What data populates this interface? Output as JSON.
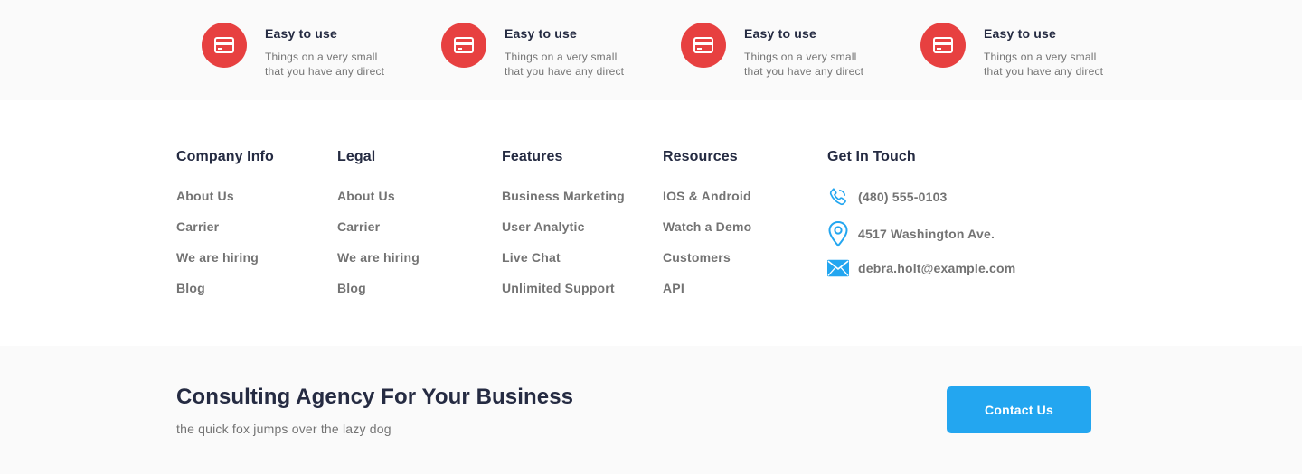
{
  "features": [
    {
      "icon": "credit-card-icon",
      "title": "Easy to use",
      "description": "Things on a very  small\nthat you have any direct"
    },
    {
      "icon": "credit-card-icon",
      "title": "Easy to use",
      "description": "Things on a very  small\nthat you have any direct"
    },
    {
      "icon": "credit-card-icon",
      "title": "Easy to use",
      "description": "Things on a very  small\nthat you have any direct"
    },
    {
      "icon": "credit-card-icon",
      "title": "Easy to use",
      "description": "Things on a very  small\nthat you have any direct"
    }
  ],
  "footer": {
    "columns": [
      {
        "title": "Company Info",
        "links": [
          "About Us",
          "Carrier",
          "We are hiring",
          "Blog"
        ]
      },
      {
        "title": "Legal",
        "links": [
          "About Us",
          "Carrier",
          "We are hiring",
          "Blog"
        ]
      },
      {
        "title": "Features",
        "links": [
          "Business Marketing",
          "User Analytic",
          "Live Chat",
          "Unlimited Support"
        ]
      },
      {
        "title": "Resources",
        "links": [
          "IOS & Android",
          "Watch a Demo",
          "Customers",
          "API"
        ]
      }
    ],
    "contact": {
      "title": "Get In Touch",
      "phone": "(480) 555-0103",
      "address": "4517 Washington Ave.",
      "email": "debra.holt@example.com"
    }
  },
  "cta": {
    "title": "Consulting Agency For Your Business",
    "subtitle": "the quick fox jumps over the lazy dog",
    "button_label": "Contact Us"
  },
  "colors": {
    "accent_red": "#E74040",
    "primary_blue": "#23A6F0",
    "heading": "#252B42",
    "muted_text": "#737373",
    "light_bg": "#FAFAFA"
  }
}
